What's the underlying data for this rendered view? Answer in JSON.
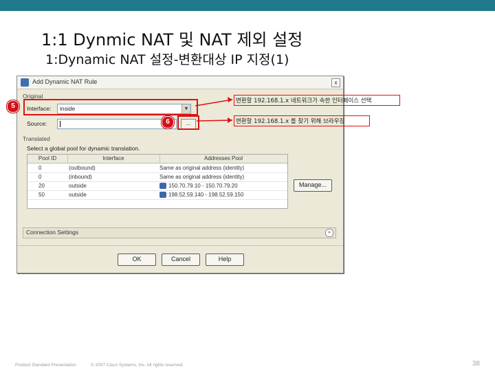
{
  "slide": {
    "title": "1:1 Dynmic NAT 및 NAT 제외 설정",
    "subtitle": "1:Dynamic NAT 설정-변환대상 IP 지정(1)",
    "accent_color": "#1f7a8c"
  },
  "dialog": {
    "title": "Add Dynamic NAT Rule",
    "close_glyph": "x",
    "original_group_label": "Original",
    "interface_label": "Interface:",
    "interface_value": "inside",
    "source_label": "Source:",
    "source_value": "",
    "browse_label": "...",
    "translated_group_label": "Translated",
    "translated_instruction": "Select a global pool for dynamic translation.",
    "pool_table": {
      "columns": [
        "Pool ID",
        "Interface",
        "Addresses Pool"
      ],
      "rows": [
        {
          "pool_id": "0",
          "interface": "(outbound)",
          "addresses": "Same as original address (identity)",
          "icon": ""
        },
        {
          "pool_id": "0",
          "interface": "(inbound)",
          "addresses": "Same as original address (identity)",
          "icon": ""
        },
        {
          "pool_id": "20",
          "interface": "outside",
          "addresses": "150.70.79.10 - 150.70.79.20",
          "icon": "pool-icon"
        },
        {
          "pool_id": "50",
          "interface": "outside",
          "addresses": "198.52.59.140 - 198.52.59.150",
          "icon": "pool-icon"
        }
      ]
    },
    "manage_label": "Manage...",
    "connection_settings_label": "Connection Settings",
    "ok_label": "OK",
    "cancel_label": "Cancel",
    "help_label": "Help"
  },
  "annotations": {
    "badge_5": "5",
    "badge_6": "6",
    "callout_1": "변환할 192.168.1.x 네트워크가 속한 인터페이스 선택",
    "callout_2": "변환할 192.168.1.x 를 찾기 위해 브라우징",
    "highlight_color": "#e01010"
  },
  "footer": {
    "left": "Product Standard Presentation",
    "center": "© 2007 Cisco Systems, Inc. All rights reserved.",
    "page": "38"
  }
}
